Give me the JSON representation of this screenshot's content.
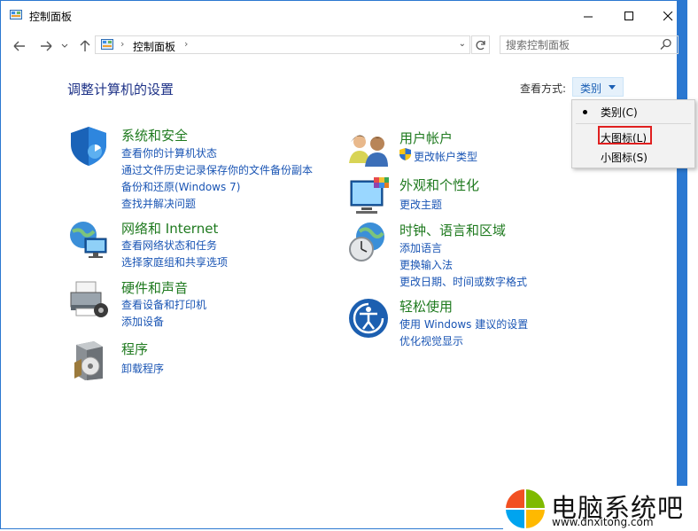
{
  "window": {
    "title": "控制面板",
    "accent_color": "#2b78d1"
  },
  "address_bar": {
    "breadcrumb": "控制面板"
  },
  "search": {
    "placeholder": "搜索控制面板"
  },
  "main": {
    "page_title": "调整计算机的设置",
    "view_by_label": "查看方式:",
    "view_by_value": "类别"
  },
  "view_menu": {
    "items": [
      {
        "label": "类别(C)",
        "selected": true
      },
      {
        "label": "大图标(L)",
        "highlighted": true
      },
      {
        "label": "小图标(S)"
      }
    ]
  },
  "categories_left": [
    {
      "title": "系统和安全",
      "icon": "shield-icon",
      "links": [
        "查看你的计算机状态",
        "通过文件历史记录保存你的文件备份副本",
        "备份和还原(Windows 7)",
        "查找并解决问题"
      ]
    },
    {
      "title": "网络和 Internet",
      "icon": "network-globe-icon",
      "links": [
        "查看网络状态和任务",
        "选择家庭组和共享选项"
      ]
    },
    {
      "title": "硬件和声音",
      "icon": "printer-icon",
      "links": [
        "查看设备和打印机",
        "添加设备"
      ]
    },
    {
      "title": "程序",
      "icon": "programs-disc-icon",
      "links": [
        "卸载程序"
      ]
    }
  ],
  "categories_right": [
    {
      "title": "用户帐户",
      "icon": "users-icon",
      "links": [
        "更改帐户类型"
      ]
    },
    {
      "title": "外观和个性化",
      "icon": "monitor-color-icon",
      "links": [
        "更改主题"
      ]
    },
    {
      "title": "时钟、语言和区域",
      "icon": "clock-globe-icon",
      "links": [
        "添加语言",
        "更换输入法",
        "更改日期、时间或数字格式"
      ]
    },
    {
      "title": "轻松使用",
      "icon": "ease-of-access-icon",
      "links": [
        "使用 Windows 建议的设置",
        "优化视觉显示"
      ]
    }
  ],
  "watermark": {
    "name": "电脑系统吧",
    "url": "www.dnxitong.com"
  }
}
